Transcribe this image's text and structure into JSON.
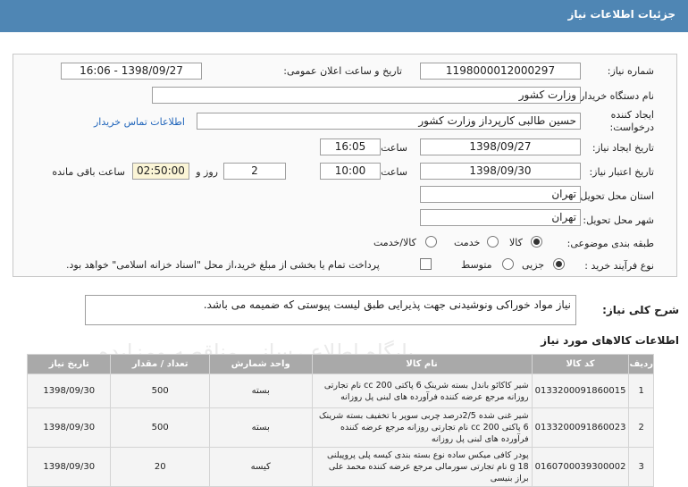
{
  "header": {
    "title": "جزئیات اطلاعات نیاز"
  },
  "form": {
    "need_number_label": "شماره نیاز:",
    "need_number": "1198000012000297",
    "announce_label": "تاریخ و ساعت اعلان عمومی:",
    "announce_value": "1398/09/27 - 16:06",
    "buyer_label": "نام دستگاه خریدار:",
    "buyer_value": "وزارت کشور",
    "creator_label_1": "ایجاد کننده",
    "creator_label_2": "درخواست:",
    "creator_value": "حسین طالبی کارپرداز وزارت کشور",
    "contact_link": "اطلاعات تماس خریدار",
    "created_date_label": "تاریخ ایجاد نیاز:",
    "created_date": "1398/09/27",
    "time_label": "ساعت",
    "created_time": "16:05",
    "valid_date_label": "تاریخ اعتبار نیاز:",
    "valid_date": "1398/09/30",
    "valid_time": "10:00",
    "days_value": "2",
    "days_label": "روز و",
    "remaining_value": "02:50:00",
    "remaining_label": "ساعت باقی مانده",
    "province_label": "استان محل تحویل:",
    "province_value": "تهران",
    "city_label": "شهر محل تحویل:",
    "city_value": "تهران",
    "category_label": "طبقه بندی موضوعی:",
    "category_options": [
      "کالا",
      "خدمت",
      "کالا/خدمت"
    ],
    "process_label": "نوع فرآیند خرید :",
    "process_options": [
      "جزیی",
      "متوسط"
    ],
    "payment_note": "پرداخت تمام یا بخشی از مبلغ خرید،از محل \"اسناد خزانه اسلامی\" خواهد بود."
  },
  "description": {
    "label": "شرح کلی نیاز:",
    "text": "نیاز مواد خوراکی ونوشیدنی جهت پذیرایی طبق لیست پیوستی که ضمیمه می باشد."
  },
  "items_section_title": "اطلاعات کالاهای مورد نیاز",
  "table": {
    "headers": [
      "ردیف",
      "کد کالا",
      "نام کالا",
      "واحد شمارش",
      "تعداد / مقدار",
      "تاریخ نیاز"
    ],
    "rows": [
      [
        "1",
        "0133200091860015",
        "شیر کاکائو باندل بسته شرینک 6 پاکتی 200 cc نام تجارتی روزانه مرجع عرضه کننده فرآورده های لبنی پل روزانه",
        "بسته",
        "500",
        "1398/09/30"
      ],
      [
        "2",
        "0133200091860023",
        "شیر غنی شده 2/5درصد چربی سوپر با تخفیف بسته شرینک 6 پاکتی 200 cc نام تجارتی روزانه مرجع عرضه کننده فرآورده های لبنی پل روزانه",
        "بسته",
        "500",
        "1398/09/30"
      ],
      [
        "3",
        "0160700039300002",
        "پودر کافی میکس ساده نوع بسته بندی کیسه پلی پروپیلنی 18 g نام تجارتی سورمالی مرجع عرضه کننده محمد علی براز بنیسی",
        "کیسه",
        "20",
        "1398/09/30"
      ]
    ]
  },
  "watermark": "پایگاه اطلاع رسانی مناقصه ومزایده"
}
